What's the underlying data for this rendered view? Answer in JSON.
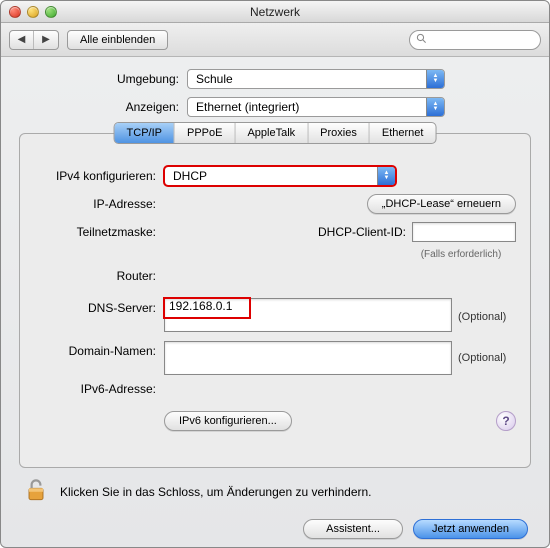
{
  "window": {
    "title": "Netzwerk"
  },
  "toolbar": {
    "show_all": "Alle einblenden",
    "search_placeholder": ""
  },
  "location": {
    "label": "Umgebung:",
    "value": "Schule"
  },
  "show": {
    "label": "Anzeigen:",
    "value": "Ethernet (integriert)"
  },
  "tabs": {
    "tcpip": "TCP/IP",
    "pppoe": "PPPoE",
    "appletalk": "AppleTalk",
    "proxies": "Proxies",
    "ethernet": "Ethernet"
  },
  "tcpip": {
    "configure_label": "IPv4 konfigurieren:",
    "configure_value": "DHCP",
    "ip_label": "IP-Adresse:",
    "renew_lease": "„DHCP-Lease“ erneuern",
    "subnet_label": "Teilnetzmaske:",
    "dhcp_client_label": "DHCP-Client-ID:",
    "dhcp_client_value": "",
    "dhcp_client_hint": "(Falls erforderlich)",
    "router_label": "Router:",
    "dns_label": "DNS-Server:",
    "dns_value": "192.168.0.1",
    "domain_label": "Domain-Namen:",
    "domain_value": "",
    "optional": "(Optional)",
    "ipv6addr_label": "IPv6-Adresse:",
    "ipv6_configure": "IPv6 konfigurieren..."
  },
  "lock_text": "Klicken Sie in das Schloss, um Änderungen zu verhindern.",
  "footer": {
    "assist": "Assistent...",
    "apply": "Jetzt anwenden"
  }
}
